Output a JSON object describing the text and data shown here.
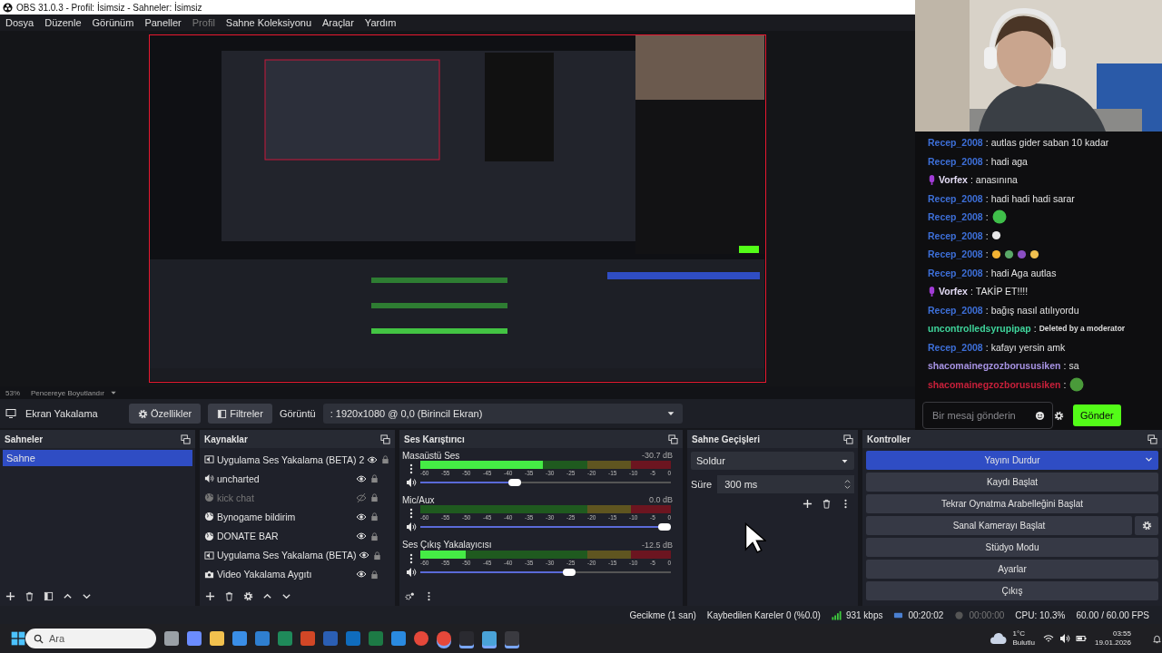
{
  "window": {
    "title": "OBS 31.0.3 - Profil: İsimsiz - Sahneler: İsimsiz"
  },
  "menu": [
    {
      "label": "Dosya",
      "disabled": false
    },
    {
      "label": "Düzenle",
      "disabled": false
    },
    {
      "label": "Görünüm",
      "disabled": false
    },
    {
      "label": "Paneller",
      "disabled": false
    },
    {
      "label": "Profil",
      "disabled": true
    },
    {
      "label": "Sahne Koleksiyonu",
      "disabled": false
    },
    {
      "label": "Araçlar",
      "disabled": false
    },
    {
      "label": "Yardım",
      "disabled": false
    }
  ],
  "preview_bar": {
    "zoom": "53%",
    "scale_mode": "Pencereye Boyutlandır"
  },
  "source_toolbar": {
    "source": "Ekran Yakalama",
    "buttons": [
      {
        "label": "Özellikler",
        "kind": "properties"
      },
      {
        "label": "Filtreler",
        "kind": "filters"
      }
    ],
    "display_label": "Görüntü",
    "display_value": ": 1920x1080 @ 0,0 (Birincil Ekran)"
  },
  "chat": {
    "messages": [
      {
        "user": "Recep_2008",
        "color": "#3d6fd8",
        "badge": false,
        "kind": "text",
        "text": "autlas gider saban 10 kadar"
      },
      {
        "user": "Recep_2008",
        "color": "#3d6fd8",
        "badge": false,
        "kind": "text",
        "text": "hadi aga"
      },
      {
        "user": "Vorfex",
        "color": "#e4dcf5",
        "badge": true,
        "kind": "text",
        "text": "anasınına"
      },
      {
        "user": "Recep_2008",
        "color": "#3d6fd8",
        "badge": false,
        "kind": "text",
        "text": "hadi hadi hadi sarar"
      },
      {
        "user": "Recep_2008",
        "color": "#3d6fd8",
        "badge": false,
        "kind": "emotes",
        "emotes": [
          {
            "kind": "face"
          }
        ]
      },
      {
        "user": "Recep_2008",
        "color": "#3d6fd8",
        "badge": false,
        "kind": "emotes",
        "emotes": [
          {
            "kind": "hand"
          }
        ]
      },
      {
        "user": "Recep_2008",
        "color": "#3d6fd8",
        "badge": false,
        "kind": "emotes",
        "emotes": [
          {
            "kind": "point"
          },
          {
            "kind": "house"
          },
          {
            "kind": "eggplant"
          },
          {
            "kind": "smile"
          }
        ]
      },
      {
        "user": "Recep_2008",
        "color": "#3d6fd8",
        "badge": false,
        "kind": "text",
        "text": "hadi Aga autlas"
      },
      {
        "user": "Vorfex",
        "color": "#e4dcf5",
        "badge": true,
        "kind": "text",
        "text": "TAKİP ET!!!!"
      },
      {
        "user": "Recep_2008",
        "color": "#3d6fd8",
        "badge": false,
        "kind": "text",
        "text": "bağış nasıl atılıyordu"
      },
      {
        "user": "uncontrolledsyrupipap",
        "color": "#3fd49b",
        "badge": false,
        "kind": "deleted",
        "text": "Deleted by a moderator"
      },
      {
        "user": "Recep_2008",
        "color": "#3d6fd8",
        "badge": false,
        "kind": "text",
        "text": "kafayı yersin amk"
      },
      {
        "user": "shacomainegzozborususiken",
        "color": "#a793e3",
        "badge": false,
        "kind": "text",
        "text": "sa"
      },
      {
        "user": "shacomainegzozborususiken",
        "color": "#c8203a",
        "badge": false,
        "kind": "emotes",
        "emotes": [
          {
            "kind": "frog"
          }
        ]
      }
    ],
    "separator": ":",
    "input": {
      "placeholder": "Bir mesaj gönderin"
    },
    "send": "Gönder"
  },
  "scenes": {
    "title": "Sahneler",
    "items": [
      {
        "label": "Sahne",
        "selected": true
      }
    ]
  },
  "sources": {
    "title": "Kaynaklar",
    "items": [
      {
        "label": "Uygulama Ses Yakalama (BETA) 2",
        "kind": "app-audio",
        "visible": true
      },
      {
        "label": "uncharted",
        "kind": "audio",
        "visible": true
      },
      {
        "label": "kick chat",
        "kind": "browser",
        "visible": false
      },
      {
        "label": "Bynogame bildirim",
        "kind": "browser",
        "visible": true
      },
      {
        "label": "DONATE BAR",
        "kind": "browser",
        "visible": true
      },
      {
        "label": "Uygulama Ses Yakalama (BETA)",
        "kind": "app-audio",
        "visible": true
      },
      {
        "label": "Video Yakalama Aygıtı",
        "kind": "camera",
        "visible": true
      }
    ]
  },
  "mixer": {
    "title": "Ses Karıştırıcı",
    "channels": [
      {
        "name": "Masaüstü Ses",
        "reading": "-30.7 dB",
        "meter": {
          "level": 0.49
        },
        "fader": {
          "level": 0.37
        },
        "scale": [
          "-60",
          "-55",
          "-50",
          "-45",
          "-40",
          "-35",
          "-30",
          "-25",
          "-20",
          "-15",
          "-10",
          "-5",
          "0"
        ]
      },
      {
        "name": "Mic/Aux",
        "reading": "0.0 dB",
        "meter": {
          "level": 0
        },
        "fader": {
          "level": 1
        },
        "scale": [
          "-60",
          "-55",
          "-50",
          "-45",
          "-40",
          "-35",
          "-30",
          "-25",
          "-20",
          "-15",
          "-10",
          "-5",
          "0"
        ]
      },
      {
        "name": "Ses Çıkış Yakalayıcısı",
        "reading": "-12.5 dB",
        "meter": {
          "level": 0.18
        },
        "fader": {
          "level": 0.6
        },
        "scale": [
          "-60",
          "-55",
          "-50",
          "-45",
          "-40",
          "-35",
          "-30",
          "-25",
          "-20",
          "-15",
          "-10",
          "-5",
          "0"
        ]
      }
    ]
  },
  "transitions": {
    "title": "Sahne Geçişleri",
    "transition": "Soldur",
    "duration_label": "Süre",
    "duration": "300 ms"
  },
  "controls": {
    "title": "Kontroller",
    "buttons": [
      {
        "label": "Yayını Durdur",
        "active": true,
        "settings": false
      },
      {
        "label": "Kaydı Başlat",
        "active": false,
        "settings": false
      },
      {
        "label": "Tekrar Oynatma Arabelleğini Başlat",
        "active": false,
        "settings": false
      },
      {
        "label": "Sanal Kamerayı Başlat",
        "active": false,
        "settings": true
      },
      {
        "label": "Stüdyo Modu",
        "active": false,
        "settings": false
      },
      {
        "label": "Ayarlar",
        "active": false,
        "settings": false
      },
      {
        "label": "Çıkış",
        "active": false,
        "settings": false
      }
    ]
  },
  "status": {
    "delay": "Gecikme (1 san)",
    "dropped": "Kaybedilen Kareler 0 (%0.0)",
    "bitrate": "931 kbps",
    "stream_time": "00:20:02",
    "record_time": "00:00:00",
    "cpu": "CPU: 10.3%",
    "fps": "60.00 / 60.00 FPS"
  },
  "taskbar": {
    "search": {
      "placeholder": "Ara"
    },
    "apps": [
      {
        "kind": "taskview",
        "running": false
      },
      {
        "kind": "copilot",
        "running": false
      },
      {
        "kind": "folder",
        "running": false
      },
      {
        "kind": "store",
        "running": false
      },
      {
        "kind": "photos",
        "running": false
      },
      {
        "kind": "project",
        "running": false
      },
      {
        "kind": "powerpoint",
        "running": false
      },
      {
        "kind": "word",
        "running": false
      },
      {
        "kind": "outlook",
        "running": false
      },
      {
        "kind": "excel",
        "running": false
      },
      {
        "kind": "code",
        "running": false
      },
      {
        "kind": "chrome",
        "running": false
      },
      {
        "kind": "chrome",
        "running": true
      },
      {
        "kind": "streamlabs",
        "running": true
      },
      {
        "kind": "paint",
        "running": true
      },
      {
        "kind": "obs",
        "running": true
      }
    ],
    "weather": {
      "temp": "1°C",
      "condition": "Bulutlu"
    },
    "time": "03:55",
    "date": "19.01.2026"
  }
}
